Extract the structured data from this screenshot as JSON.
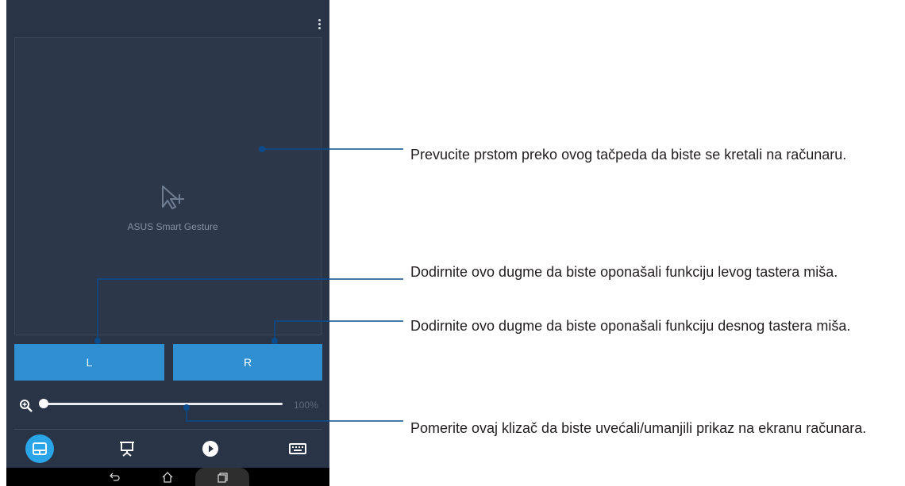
{
  "touchpad": {
    "app_label": "ASUS Smart Gesture"
  },
  "buttons": {
    "left_label": "L",
    "right_label": "R"
  },
  "zoom": {
    "value_text": "100%",
    "slider_fraction": 0.0
  },
  "tabs": [
    {
      "icon": "trackpad-icon",
      "active": true
    },
    {
      "icon": "presentation-icon",
      "active": false
    },
    {
      "icon": "play-icon",
      "active": false
    },
    {
      "icon": "keyboard-icon",
      "active": false
    }
  ],
  "colors": {
    "background": "#2a3447",
    "accent": "#2f8fd1",
    "active_tab": "#2aa6e8",
    "callout_line": "#0b4b8c"
  },
  "callouts": {
    "touchpad": "Prevucite prstom preko ovog tačpeda da biste se kretali na računaru.",
    "left_button": "Dodirnite ovo dugme da biste oponašali funkciju levog tastera miša.",
    "right_button": "Dodirnite ovo dugme da biste oponašali funkciju desnog tastera miša.",
    "slider": "Pomerite ovaj klizač da biste uvećali/umanjili prikaz na ekranu računara."
  }
}
